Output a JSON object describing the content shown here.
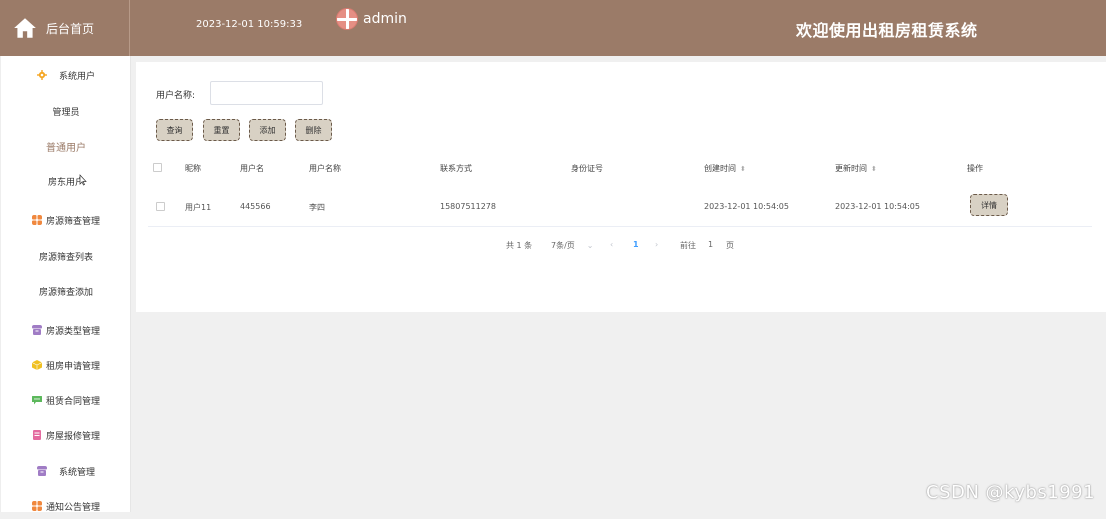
{
  "header": {
    "home_label": "后台首页",
    "datetime": "2023-12-01 10:59:33",
    "username": "admin",
    "site_title": "欢迎使用出租房租赁系统"
  },
  "sidebar": {
    "items": [
      {
        "label": "系统用户",
        "icon": "gear-icon",
        "color": "#f5a623"
      },
      {
        "label": "管理员",
        "sub": true
      },
      {
        "label": "普通用户",
        "sub": true,
        "active": true
      },
      {
        "label": "房东用户",
        "sub": true
      },
      {
        "label": "房源筛查管理",
        "icon": "grid-icon",
        "color": "#f0883e"
      },
      {
        "label": "房源筛查列表",
        "sub": true
      },
      {
        "label": "房源筛查添加",
        "sub": true
      },
      {
        "label": "房源类型管理",
        "icon": "box-icon",
        "color": "#a07cc5"
      },
      {
        "label": "租房申请管理",
        "icon": "cube-icon",
        "color": "#f0c020"
      },
      {
        "label": "租赁合同管理",
        "icon": "chat-icon",
        "color": "#5cb85c"
      },
      {
        "label": "房屋报修管理",
        "icon": "doc-icon",
        "color": "#e46ba0"
      },
      {
        "label": "系统管理",
        "icon": "box-icon",
        "color": "#a07cc5"
      },
      {
        "label": "通知公告管理",
        "icon": "grid-icon",
        "color": "#f0883e"
      }
    ]
  },
  "search": {
    "label": "用户名称:",
    "value": "",
    "placeholder": ""
  },
  "buttons": {
    "query": "查询",
    "reset": "重置",
    "add": "添加",
    "delete": "删除"
  },
  "table": {
    "headers": {
      "nickname": "昵称",
      "username": "用户名",
      "fullname": "用户名称",
      "phone": "联系方式",
      "idcard": "身份证号",
      "created": "创建时间",
      "updated": "更新时间",
      "actions": "操作"
    },
    "rows": [
      {
        "nickname": "用户11",
        "username": "445566",
        "fullname": "李四",
        "phone": "15807511278",
        "idcard": "",
        "created": "2023-12-01 10:54:05",
        "updated": "2023-12-01 10:54:05",
        "action": "详情"
      }
    ]
  },
  "pagination": {
    "total": "共 1 条",
    "page_size": "7条/页",
    "current_page": "1",
    "goto_label": "前往",
    "goto_value": "1",
    "page_unit": "页"
  },
  "watermark": "CSDN @kybs1991"
}
